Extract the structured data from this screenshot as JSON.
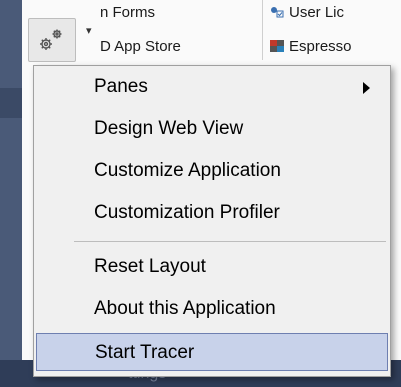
{
  "background": {
    "toolbar_items": [
      {
        "label": "n Forms"
      },
      {
        "label": "D App Store"
      },
      {
        "label": "User Lic"
      },
      {
        "label": "Espresso"
      }
    ],
    "bottom_text": "ttings"
  },
  "settings_button": {
    "icon": "gear-icon",
    "chevron": "▾"
  },
  "context_menu": {
    "items": [
      {
        "label": "Panes",
        "has_submenu": true
      },
      {
        "label": "Design Web View"
      },
      {
        "label": "Customize Application"
      },
      {
        "label": "Customization Profiler"
      },
      {
        "label": "Reset Layout"
      },
      {
        "label": "About this Application"
      },
      {
        "label": "Start Tracer",
        "highlighted": true
      }
    ],
    "colors": {
      "highlight": "#c8d2ea",
      "highlight_border": "#6e7fb0"
    }
  }
}
